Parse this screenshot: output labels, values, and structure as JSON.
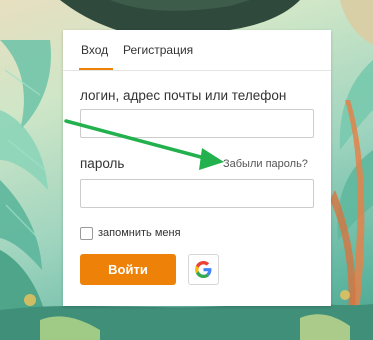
{
  "tabs": {
    "login": "Вход",
    "register": "Регистрация"
  },
  "form": {
    "login_label": "логин, адрес почты или телефон",
    "login_value": "",
    "password_label": "пароль",
    "password_value": "",
    "forgot_password": "Забыли пароль?",
    "remember_me": "запомнить меня",
    "remember_checked": false,
    "submit_label": "Войти",
    "google_icon": "google-icon"
  },
  "colors": {
    "accent": "#ee8208",
    "annotation_arrow": "#22b14c"
  }
}
